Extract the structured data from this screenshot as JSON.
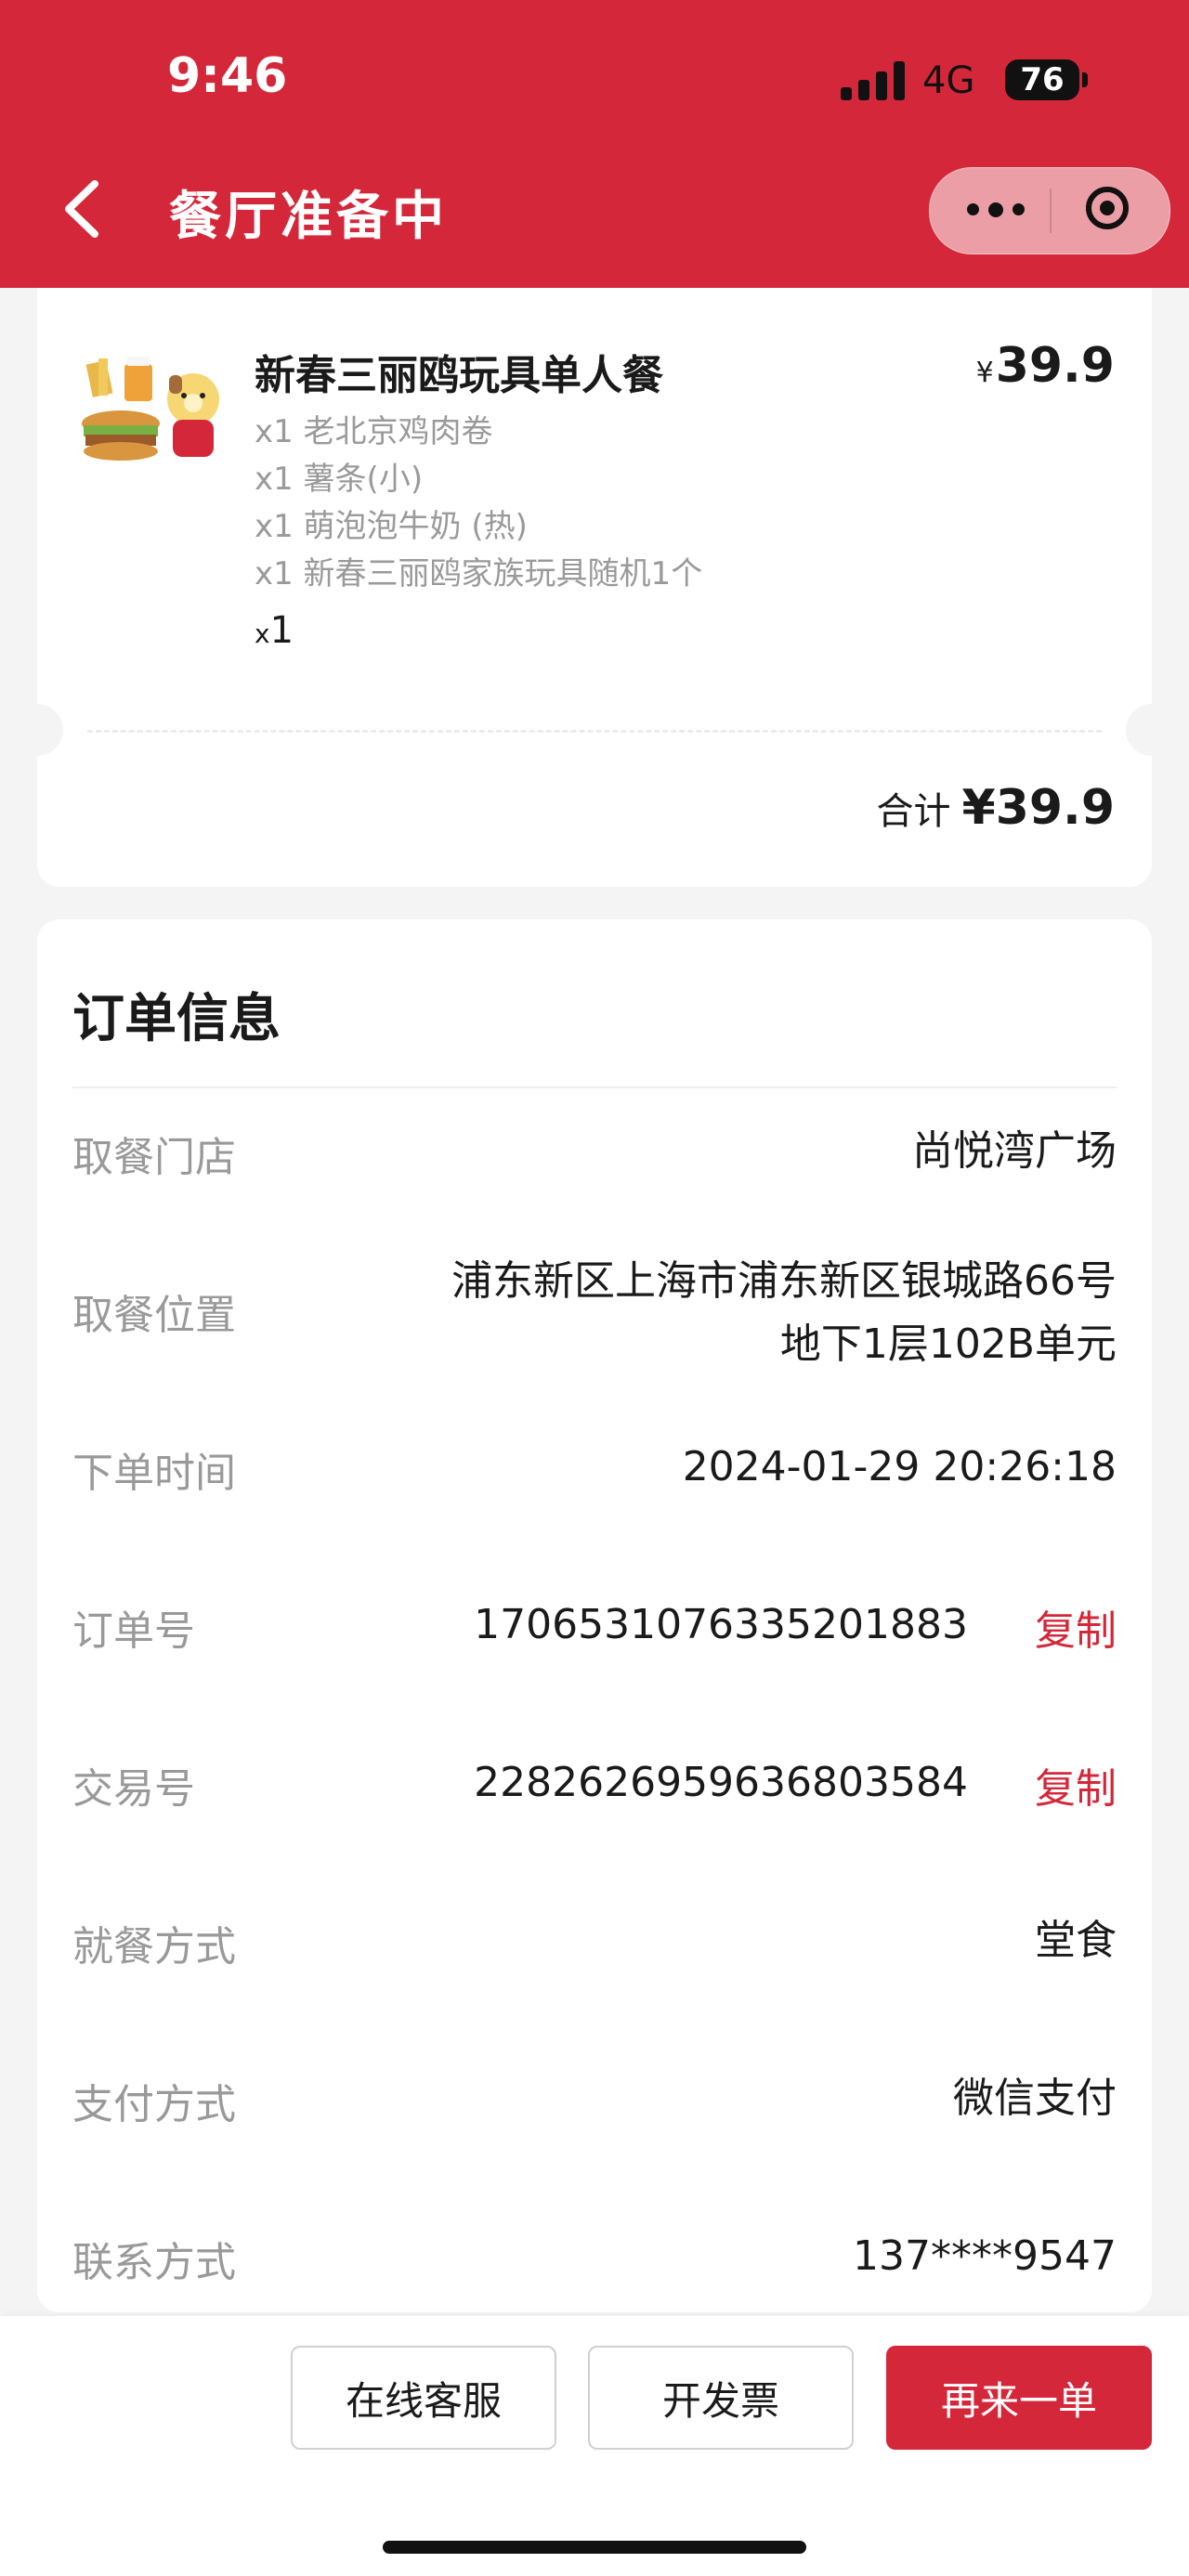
{
  "status_bar": {
    "time": "9:46",
    "network": "4G",
    "battery": "76"
  },
  "header": {
    "title": "餐厅准备中"
  },
  "order_item": {
    "name": "新春三丽鸥玩具单人餐",
    "price_symbol": "¥",
    "price": "39.9",
    "sub_items": [
      "x1 老北京鸡肉卷",
      "x1 薯条(小)",
      "x1 萌泡泡牛奶 (热)",
      "x1 新春三丽鸥家族玩具随机1个"
    ],
    "qty_prefix": "x",
    "qty": "1",
    "total_label": "合计",
    "total_value": "¥39.9"
  },
  "order_info": {
    "title": "订单信息",
    "copy_label": "复制",
    "rows": [
      {
        "label": "取餐门店",
        "value": "尚悦湾广场"
      },
      {
        "label": "取餐位置",
        "value_line1": "浦东新区上海市浦东新区银城路66号",
        "value_line2": "地下1层102B单元"
      },
      {
        "label": "下单时间",
        "value": "2024-01-29 20:26:18"
      },
      {
        "label": "订单号",
        "value": "1706531076335201883"
      },
      {
        "label": "交易号",
        "value": "2282626959636803584"
      },
      {
        "label": "就餐方式",
        "value": "堂食"
      },
      {
        "label": "支付方式",
        "value": "微信支付"
      },
      {
        "label": "联系方式",
        "value": "137****9547"
      }
    ]
  },
  "bottom_bar": {
    "service_label": "在线客服",
    "invoice_label": "开发票",
    "reorder_label": "再来一单"
  },
  "colors": {
    "brand_red": "#d4283a",
    "background": "#f4f4f4"
  }
}
